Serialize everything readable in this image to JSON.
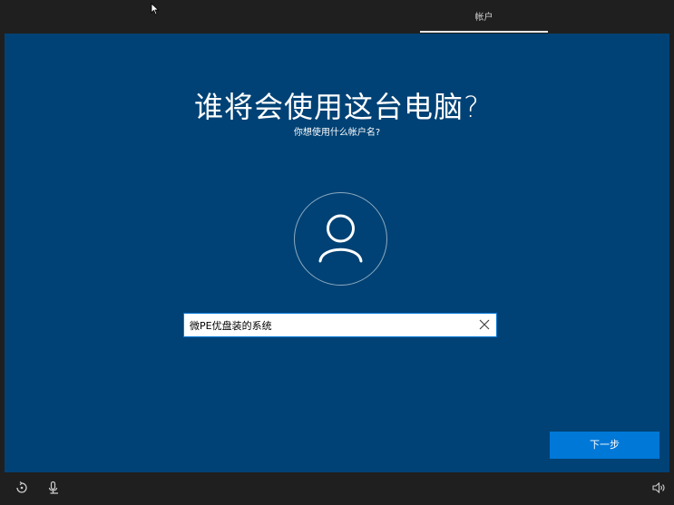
{
  "header": {
    "tab_label": "帐户"
  },
  "main": {
    "title": "谁将会使用这台电脑?",
    "subtitle": "你想使用什么帐户名?",
    "username_value": "微PE优盘装的系统",
    "next_label": "下一步"
  },
  "icons": {
    "avatar": "user-icon",
    "clear": "close-icon",
    "ease_of_access": "ease-of-access-icon",
    "microphone": "microphone-icon",
    "volume": "volume-icon",
    "cursor": "mouse-pointer-icon"
  },
  "colors": {
    "panel": "#004275",
    "accent": "#0078d7",
    "bars": "#1f1f1f"
  }
}
